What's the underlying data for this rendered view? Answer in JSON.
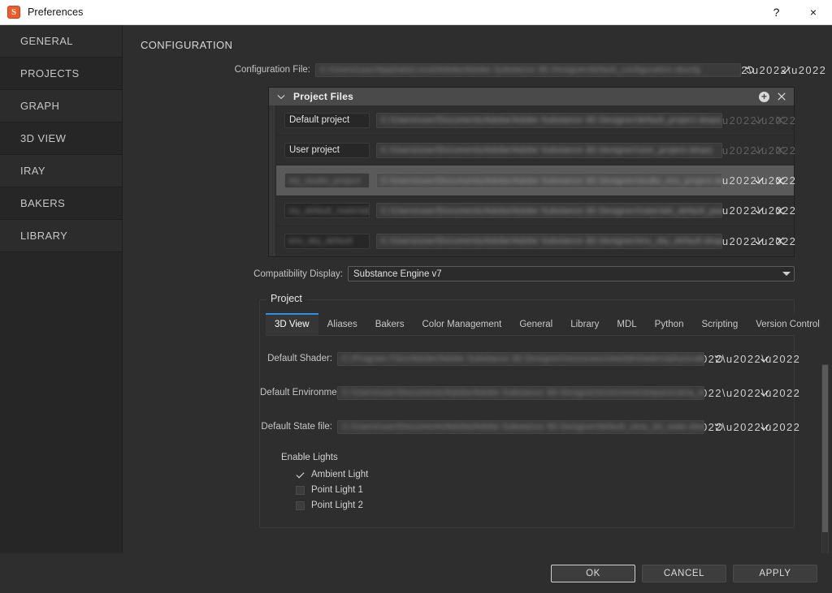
{
  "window": {
    "title": "Preferences",
    "app_icon": "substance-designer-icon",
    "help_label": "?",
    "close_label": "×"
  },
  "sidebar": {
    "items": [
      {
        "label": "GENERAL"
      },
      {
        "label": "PROJECTS"
      },
      {
        "label": "GRAPH"
      },
      {
        "label": "3D VIEW"
      },
      {
        "label": "IRAY"
      },
      {
        "label": "BAKERS"
      },
      {
        "label": "LIBRARY"
      }
    ]
  },
  "configuration": {
    "heading": "CONFIGURATION",
    "config_file_label": "Configuration File:",
    "config_file_value": "C:/Users/user/AppData/Local/Adobe/Adobe Substance 3D Designer/default_configuration.sbscfg",
    "reset_icon": "reset-icon",
    "browse_icon": "ellipsis-icon",
    "confirm_icon": "check-icon"
  },
  "project_files": {
    "title": "Project Files",
    "collapse_icon": "chevron-down-icon",
    "add_icon": "plus-circle-icon",
    "close_icon": "close-icon",
    "rows": [
      {
        "name": "Default project",
        "path": "C:/Users/user/Documents/Adobe/Adobe Substance 3D Designer/default_project.sbsprj",
        "editable": false
      },
      {
        "name": "User project",
        "path": "C:/Users/user/Documents/Adobe/Adobe Substance 3D Designer/user_project.sbsprj",
        "editable": false
      },
      {
        "name": "my_studio_project",
        "path": "C:/Users/user/Documents/Adobe/Adobe Substance 3D Designer/studio_env_project.sbsprj",
        "editable": true,
        "selected": true
      },
      {
        "name": "my_default_materials",
        "path": "C:/Users/user/Documents/Adobe/Adobe Substance 3D Designer/materials_default_pack.sbsprj",
        "editable": true
      },
      {
        "name": "env_sky_default",
        "path": "C:/Users/user/Documents/Adobe/Adobe Substance 3D Designer/env_sky_default.sbsprj",
        "editable": true
      }
    ]
  },
  "compatibility": {
    "label": "Compatibility Display:",
    "value": "Substance Engine v7",
    "caret_icon": "chevron-down-icon"
  },
  "project": {
    "legend": "Project",
    "tabs": [
      {
        "label": "3D View",
        "active": true
      },
      {
        "label": "Aliases",
        "active": false
      },
      {
        "label": "Bakers",
        "active": false
      },
      {
        "label": "Color Management",
        "active": false
      },
      {
        "label": "General",
        "active": false
      },
      {
        "label": "Library",
        "active": false
      },
      {
        "label": "MDL",
        "active": false
      },
      {
        "label": "Python",
        "active": false
      },
      {
        "label": "Scripting",
        "active": false
      },
      {
        "label": "Version Control",
        "active": false
      }
    ],
    "fields": [
      {
        "label": "Default Shader:",
        "value": "C:/Program Files/Adobe/Adobe Substance 3D Designer/resources/view3d/shaders/physically_metallic_roughness.glslfx",
        "has_reset": true
      },
      {
        "label": "Default Environment Map:",
        "value": "C:/Users/user/Documents/Adobe/Adobe Substance 3D Designer/environments/panorama_env_white.exr",
        "has_reset": false
      },
      {
        "label": "Default State file:",
        "value": "C:/Users/user/Documents/Adobe/Adobe Substance 3D Designer/default_view_3d_state.sbsscn",
        "has_reset": true
      }
    ],
    "lights_title": "Enable Lights",
    "lights": [
      {
        "label": "Ambient Light",
        "checked": true
      },
      {
        "label": "Point Light 1",
        "checked": false
      },
      {
        "label": "Point Light 2",
        "checked": false
      }
    ]
  },
  "footer": {
    "ok": "OK",
    "cancel": "CANCEL",
    "apply": "APPLY"
  },
  "colors": {
    "accent": "#2f8fe0",
    "brand": "#f05a28",
    "panel_header": "#4a4a4a",
    "selection": "#5a5a5a"
  }
}
